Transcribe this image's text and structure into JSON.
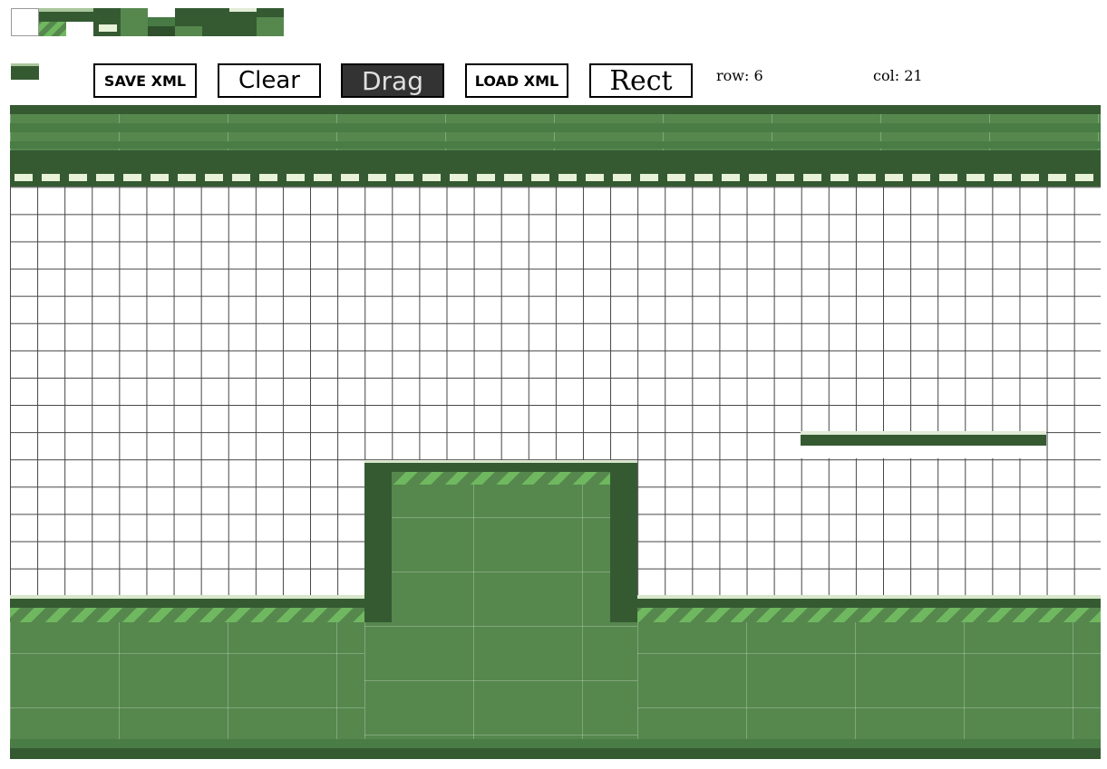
{
  "palette": {
    "tiles": [
      "blank",
      "grass-top",
      "dark",
      "platform",
      "mid",
      "mid-dark",
      "stripe",
      "light",
      "dark-2",
      "mid-2"
    ]
  },
  "toolbar": {
    "save_label": "SAVE XML",
    "clear_label": "Clear",
    "drag_label": "Drag",
    "load_label": "LOAD XML",
    "rect_label": "Rect"
  },
  "status": {
    "row": "row: 6",
    "col": "col: 21"
  },
  "colors": {
    "dark_green": "#355a32",
    "mid_green": "#56884e",
    "stripe_green": "#6fb85f",
    "highlight": "#e8f2d8",
    "grid": "#444444"
  }
}
